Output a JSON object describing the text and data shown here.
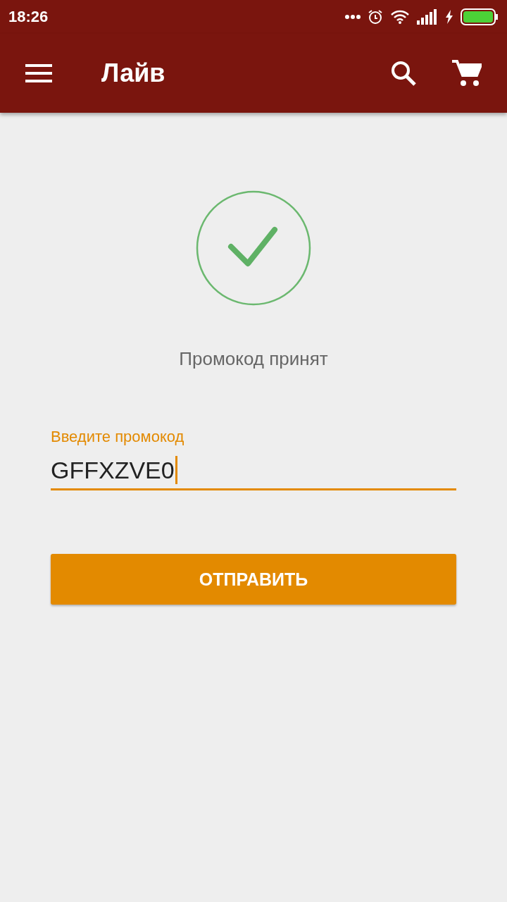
{
  "status_bar": {
    "time": "18:26"
  },
  "toolbar": {
    "title": "Лайв"
  },
  "result": {
    "kind": "success",
    "message": "Промокод принят"
  },
  "promo_field": {
    "label": "Введите промокод",
    "value": "GFFXZVE0",
    "focused": true
  },
  "submit_button": {
    "label": "ОТПРАВИТЬ"
  }
}
